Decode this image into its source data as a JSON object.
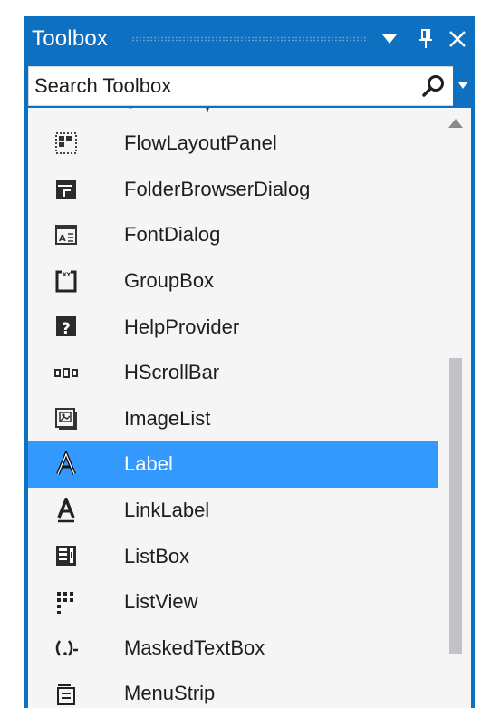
{
  "toolbox": {
    "title": "Toolbox",
    "search": {
      "value": "Search Toolbox"
    },
    "items": [
      {
        "label": "FlowLayoutPanel",
        "icon": "flowlayoutpanel-icon"
      },
      {
        "label": "FolderBrowserDialog",
        "icon": "folderbrowserdialog-icon"
      },
      {
        "label": "FontDialog",
        "icon": "fontdialog-icon"
      },
      {
        "label": "GroupBox",
        "icon": "groupbox-icon"
      },
      {
        "label": "HelpProvider",
        "icon": "helpprovider-icon"
      },
      {
        "label": "HScrollBar",
        "icon": "hscrollbar-icon"
      },
      {
        "label": "ImageList",
        "icon": "imagelist-icon"
      },
      {
        "label": "Label",
        "icon": "label-icon",
        "selected": true
      },
      {
        "label": "LinkLabel",
        "icon": "linklabel-icon"
      },
      {
        "label": "ListBox",
        "icon": "listbox-icon"
      },
      {
        "label": "ListView",
        "icon": "listview-icon"
      },
      {
        "label": "MaskedTextBox",
        "icon": "maskedtextbox-icon"
      },
      {
        "label": "MenuStrip",
        "icon": "menustrip-icon"
      }
    ]
  },
  "colors": {
    "accent": "#0e70c0",
    "selection": "#3399ff",
    "list_bg": "#f5f5f5",
    "scroll_thumb": "#c2c3c9"
  }
}
